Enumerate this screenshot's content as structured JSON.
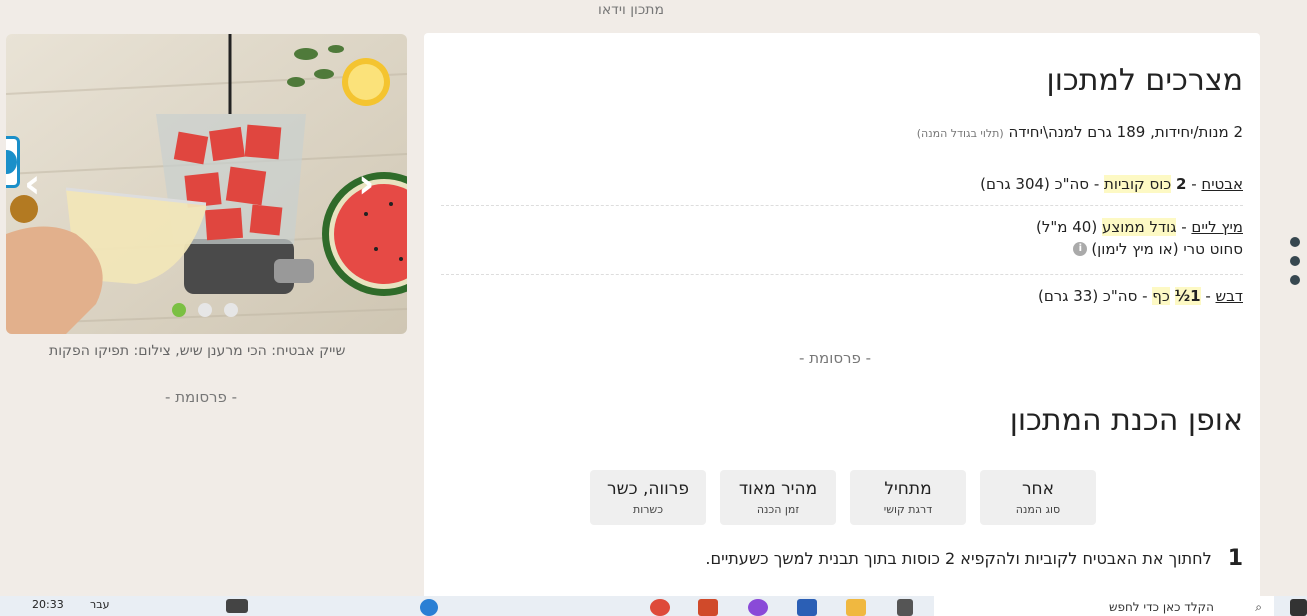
{
  "top_label": "מתכון וידאו",
  "ingredients": {
    "title": "מצרכים למתכון",
    "servings": "2 מנות/יחידות, 189 גרם למנה\\יחידה",
    "servings_note": "(תלוי בגודל המנה)",
    "items": [
      {
        "name": "אבטיח",
        "dash1": " - ",
        "qty": "2",
        "unit": "כוס קוביות",
        "dash2": " - ",
        "rest": "סה\"כ (304 גרם)"
      },
      {
        "name": "מיץ ליים",
        "dash1": " - ",
        "unit": "גודל ממוצע",
        "rest": " (40 מ\"ל)",
        "note": "סחוט טרי (או מיץ לימון)"
      },
      {
        "name": "דבש",
        "dash1": " - ",
        "qty": "1½",
        "unit": "כף",
        "dash2": " - ",
        "rest": "סה\"כ (33 גרם)"
      }
    ]
  },
  "ad_label": "- פרסומת -",
  "preparation": {
    "title": "אופן הכנת המתכון",
    "tiles": [
      {
        "value": "אחר",
        "label": "סוג המנה"
      },
      {
        "value": "מתחיל",
        "label": "דרגת קושי"
      },
      {
        "value": "מהיר מאוד",
        "label": "זמן הכנה"
      },
      {
        "value": "פרווה, כשר",
        "label": "כשרות"
      }
    ],
    "steps": [
      {
        "num": "1",
        "text": "לחתוך את האבטיח לקוביות ולהקפיא 2 כוסות בתוך תבנית למשך כשעתיים."
      }
    ]
  },
  "image": {
    "caption": "שייק אבטיח: הכי מרענן שיש, צילום: תפיקו הפקות",
    "slide": 1,
    "slides": 3
  },
  "taskbar": {
    "time": "20:33",
    "lang": "עבר",
    "search_placeholder": "הקלד כאן כדי לחפש"
  },
  "colors": {
    "active_dot": "#7bc043",
    "highlight": "#fdf9c4"
  }
}
